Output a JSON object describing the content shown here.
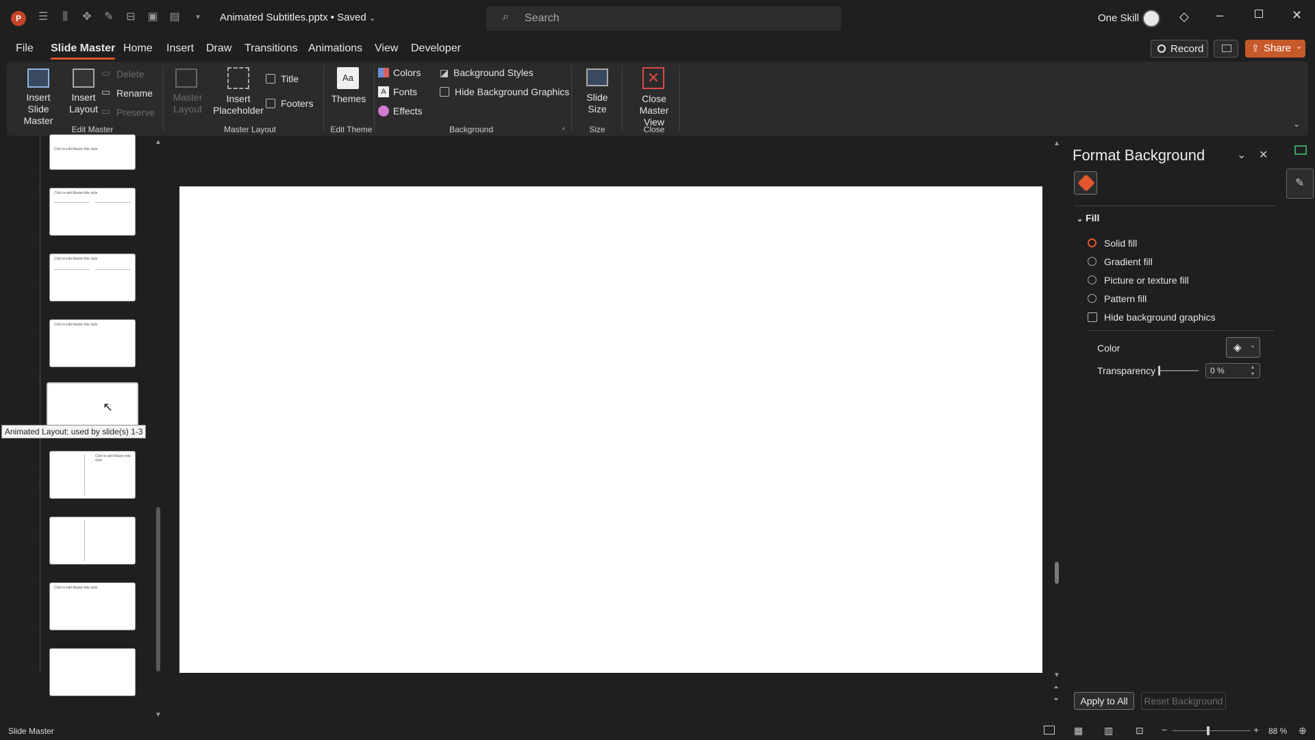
{
  "titlebar": {
    "doc_title": "Animated Subtitles.pptx • Saved",
    "search_placeholder": "Search",
    "user_name": "One Skill"
  },
  "tabs": [
    "File",
    "Slide Master",
    "Home",
    "Insert",
    "Draw",
    "Transitions",
    "Animations",
    "View",
    "Developer"
  ],
  "active_tab": "Slide Master",
  "actions": {
    "record": "Record",
    "share": "Share"
  },
  "ribbon": {
    "edit_master": {
      "label": "Edit Master",
      "insert_slide_master": "Insert Slide Master",
      "insert_layout": "Insert Layout",
      "delete": "Delete",
      "rename": "Rename",
      "preserve": "Preserve"
    },
    "master_layout": {
      "label": "Master Layout",
      "master_layout_btn": "Master Layout",
      "insert_placeholder": "Insert Placeholder",
      "title": "Title",
      "footers": "Footers"
    },
    "edit_theme": {
      "label": "Edit Theme",
      "themes": "Themes"
    },
    "background": {
      "label": "Background",
      "colors": "Colors",
      "fonts": "Fonts",
      "effects": "Effects",
      "background_styles": "Background Styles",
      "hide_bg_graphics": "Hide Background Graphics"
    },
    "size": {
      "label": "Size",
      "slide_size": "Slide Size"
    },
    "close": {
      "label": "Close",
      "close_master_view": "Close Master View"
    }
  },
  "thumbnails": {
    "title_text": "Click to edit Master title style",
    "tooltip": "Animated Layout: used by slide(s) 1-3"
  },
  "format_pane": {
    "title": "Format Background",
    "section": "Fill",
    "options": [
      {
        "label": "Solid fill",
        "selected": true
      },
      {
        "label": "Gradient fill",
        "selected": false
      },
      {
        "label": "Picture or texture fill",
        "selected": false
      },
      {
        "label": "Pattern fill",
        "selected": false
      }
    ],
    "hide_bg_graphics": "Hide background graphics",
    "color_label": "Color",
    "transparency_label": "Transparency",
    "transparency_value": "0 %",
    "apply_all": "Apply to All",
    "reset_bg": "Reset Background"
  },
  "status": {
    "view_name": "Slide Master",
    "zoom": "88 %"
  },
  "colors": {
    "accent": "#e4572e",
    "ribbon_bg": "#2b2b2b",
    "app_bg": "#1f1f1f"
  }
}
